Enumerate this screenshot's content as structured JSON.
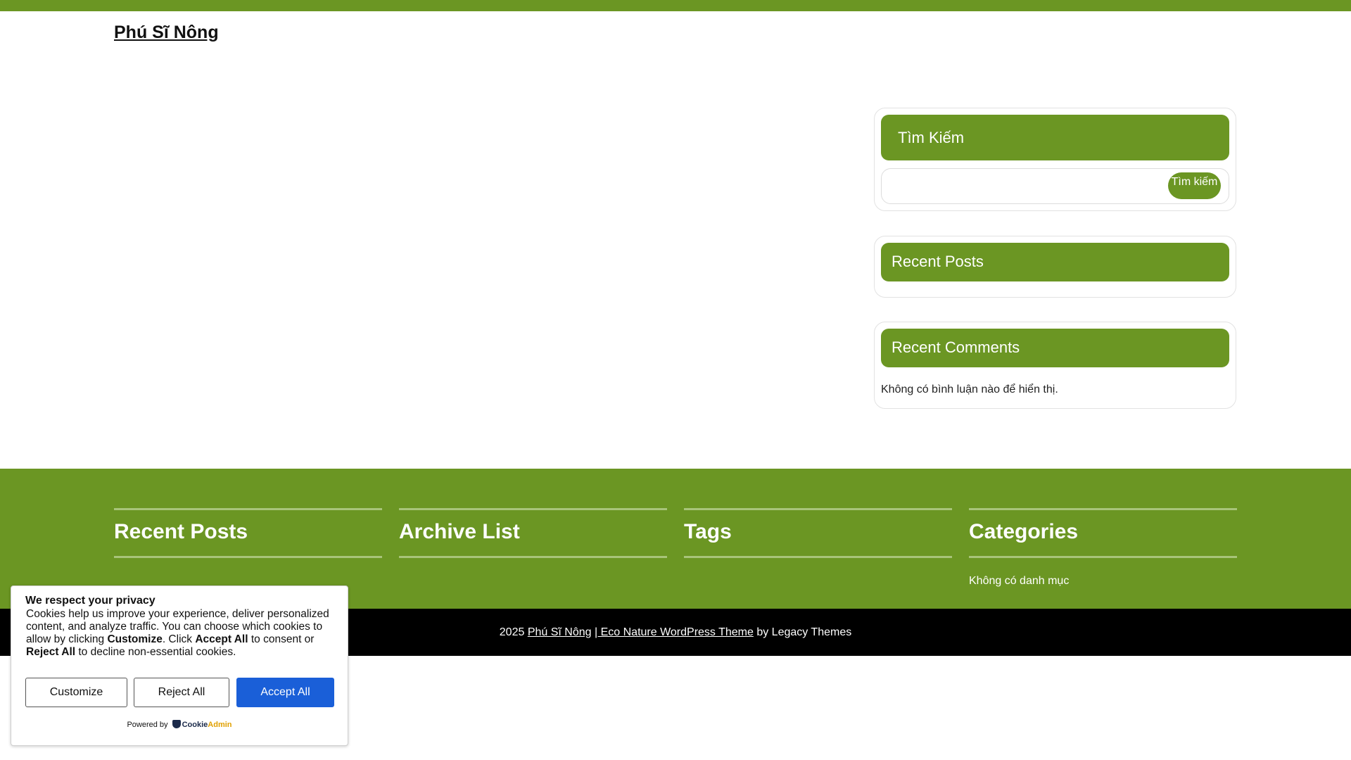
{
  "site": {
    "title": "Phú Sĩ Nông"
  },
  "sidebar": {
    "search": {
      "title": "Tìm Kiếm",
      "button_label": "Tìm kiếm",
      "value": ""
    },
    "recent_posts": {
      "title": "Recent Posts"
    },
    "recent_comments": {
      "title": "Recent Comments",
      "empty_text": "Không có bình luận nào để hiển thị."
    }
  },
  "footer": {
    "columns": [
      {
        "title": "Recent Posts",
        "item": ""
      },
      {
        "title": "Archive List",
        "item": ""
      },
      {
        "title": "Tags",
        "item": ""
      },
      {
        "title": "Categories",
        "item": "Không có danh mục"
      }
    ],
    "bottom": {
      "year": "2025",
      "site_link": "Phú Sĩ Nông",
      "theme_link": "| Eco Nature WordPress Theme",
      "by_text": "by Legacy Themes"
    }
  },
  "cookie": {
    "title": "We respect your privacy",
    "text_part1": "Cookies help us improve your experience, deliver personalized content, and analyze traffic. You can choose which cookies to allow by clicking ",
    "customize_word": "Customize",
    "text_part2": ". Click ",
    "accept_word": "Accept All",
    "text_part3": " to consent or ",
    "reject_word": "Reject All",
    "text_part4": " to decline non-essential cookies.",
    "buttons": {
      "customize": "Customize",
      "reject": "Reject All",
      "accept": "Accept All"
    },
    "powered_by": "Powered by",
    "brand_part1": "Cookie",
    "brand_part2": "Admin"
  },
  "colors": {
    "brand_green": "#6b9623",
    "accept_blue": "#1a5fd8"
  }
}
